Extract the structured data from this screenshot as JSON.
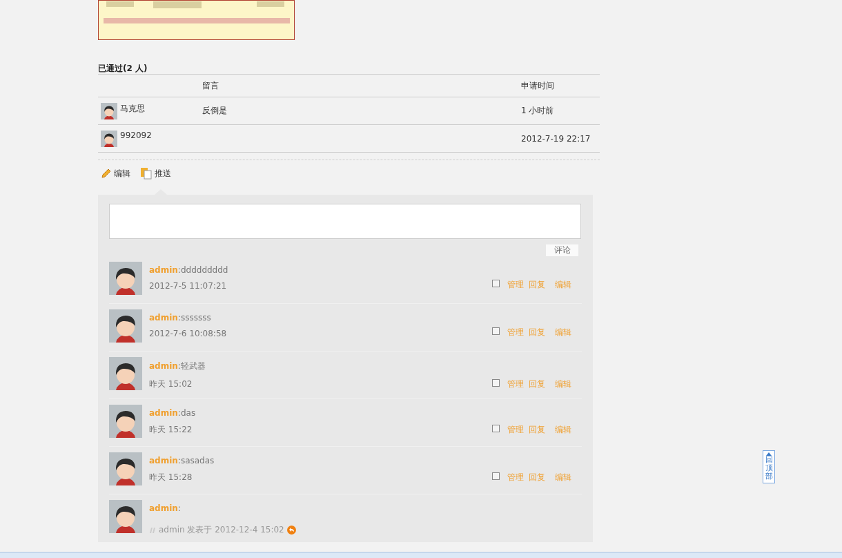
{
  "approved": {
    "title": "已通过(2 人)",
    "columns": [
      "留言",
      "申请时间"
    ],
    "rows": [
      {
        "name": "马克思",
        "message": "反倒是",
        "time": "1 小时前"
      },
      {
        "name": "992092",
        "message": "",
        "time": "2012-7-19 22:17"
      }
    ]
  },
  "actions": [
    {
      "label": "编辑",
      "kind": "edit"
    },
    {
      "label": "推送",
      "kind": "push"
    }
  ],
  "comment_box": {
    "button": "评论"
  },
  "comments": [
    {
      "kind": "comment",
      "author": "admin",
      "separator": ":",
      "text": "ddddddddd",
      "time": "2012-7-5 11:07:21",
      "checked": false,
      "links": [
        "管理",
        "回复",
        "编辑"
      ]
    },
    {
      "kind": "comment",
      "author": "admin",
      "separator": ":",
      "text": "sssssss",
      "time": "2012-7-6 10:08:58",
      "checked": false,
      "links": [
        "管理",
        "回复",
        "编辑"
      ]
    },
    {
      "kind": "comment",
      "author": "admin",
      "separator": ":",
      "text": "轻武器",
      "time": "昨天 15:02",
      "checked": false,
      "links": [
        "管理",
        "回复",
        "编辑"
      ]
    },
    {
      "kind": "comment",
      "author": "admin",
      "separator": ":",
      "text": "das",
      "time": "昨天 15:22",
      "checked": false,
      "links": [
        "管理",
        "回复",
        "编辑"
      ]
    },
    {
      "kind": "comment",
      "author": "admin",
      "separator": ":",
      "text": "sasadas",
      "time": "昨天 15:28",
      "checked": false,
      "links": [
        "管理",
        "回复",
        "编辑"
      ]
    },
    {
      "kind": "quote",
      "author": "admin",
      "separator": ":",
      "quote": "admin 发表于 2012-12-4 15:02"
    }
  ],
  "back_to_top": {
    "label": "回顶部"
  }
}
